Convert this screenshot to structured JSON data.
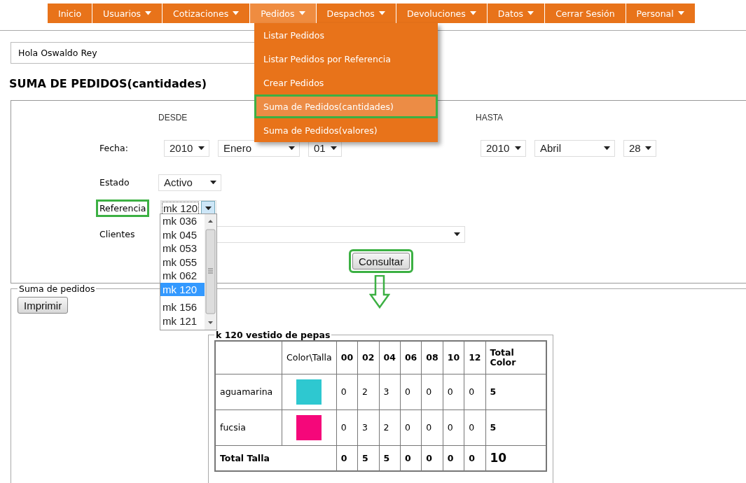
{
  "nav": {
    "items": [
      {
        "label": "Inicio",
        "has_menu": false,
        "selected": false
      },
      {
        "label": "Usuarios",
        "has_menu": true,
        "selected": false
      },
      {
        "label": "Cotizaciones",
        "has_menu": true,
        "selected": false
      },
      {
        "label": "Pedidos",
        "has_menu": true,
        "selected": true
      },
      {
        "label": "Despachos",
        "has_menu": true,
        "selected": false
      },
      {
        "label": "Devoluciones",
        "has_menu": true,
        "selected": false
      },
      {
        "label": "Datos",
        "has_menu": true,
        "selected": false
      },
      {
        "label": "Cerrar Sesión",
        "has_menu": false,
        "selected": false
      },
      {
        "label": "Personal",
        "has_menu": true,
        "selected": false
      }
    ]
  },
  "menu": {
    "items": [
      {
        "label": "Listar Pedidos",
        "selected": false,
        "highlighted": false
      },
      {
        "label": "Listar Pedidos por Referencia",
        "selected": false,
        "highlighted": false
      },
      {
        "label": "Crear Pedidos",
        "selected": false,
        "highlighted": false
      },
      {
        "label": "Suma de Pedidos(cantidades)",
        "selected": true,
        "highlighted": true
      },
      {
        "label": "Suma de Pedidos(valores)",
        "selected": false,
        "highlighted": false
      }
    ]
  },
  "greeting": "Hola Oswaldo Rey",
  "title": "SUMA DE PEDIDOS(cantidades)",
  "filters": {
    "desde": {
      "heading": "DESDE",
      "year": "2010",
      "month": "Enero",
      "day": "01"
    },
    "hasta": {
      "heading": "HASTA",
      "year": "2010",
      "month": "Abril",
      "day": "28"
    },
    "fecha_label": "Fecha:",
    "estado": {
      "label": "Estado",
      "value": "Activo"
    },
    "referencia": {
      "label": "Referencia",
      "value": "mk 120",
      "highlighted": true,
      "focused": true
    },
    "clientes": {
      "label": "Clientes"
    },
    "consultar": {
      "label": "Consultar",
      "highlighted": true
    }
  },
  "reference_list": {
    "items": [
      {
        "label": "mk 036",
        "selected": false
      },
      {
        "label": "mk 045",
        "selected": false
      },
      {
        "label": "mk 053",
        "selected": false
      },
      {
        "label": "mk 055",
        "selected": false
      },
      {
        "label": "mk 062",
        "selected": false
      },
      {
        "label": "mk 120",
        "selected": true
      },
      {
        "label": "mk 156",
        "selected": false
      },
      {
        "label": "mk 121",
        "selected": false
      }
    ]
  },
  "results": {
    "legend": "Suma de pedidos",
    "print_button": "Imprimir",
    "table_legend": "k 120 vestido de pepas",
    "columns": [
      "Color\\Talla",
      "00",
      "02",
      "04",
      "06",
      "08",
      "10",
      "12",
      "Total Color"
    ],
    "rows": [
      {
        "name": "aguamarina",
        "color": "#2ec8d0",
        "values": [
          "0",
          "2",
          "3",
          "0",
          "0",
          "0",
          "0"
        ],
        "total": "5"
      },
      {
        "name": "fucsia",
        "color": "#f5077a",
        "values": [
          "0",
          "3",
          "2",
          "0",
          "0",
          "0",
          "0"
        ],
        "total": "5"
      }
    ],
    "footer": {
      "label": "Total Talla",
      "values": [
        "0",
        "5",
        "5",
        "0",
        "0",
        "0",
        "0"
      ],
      "total": "10"
    }
  }
}
